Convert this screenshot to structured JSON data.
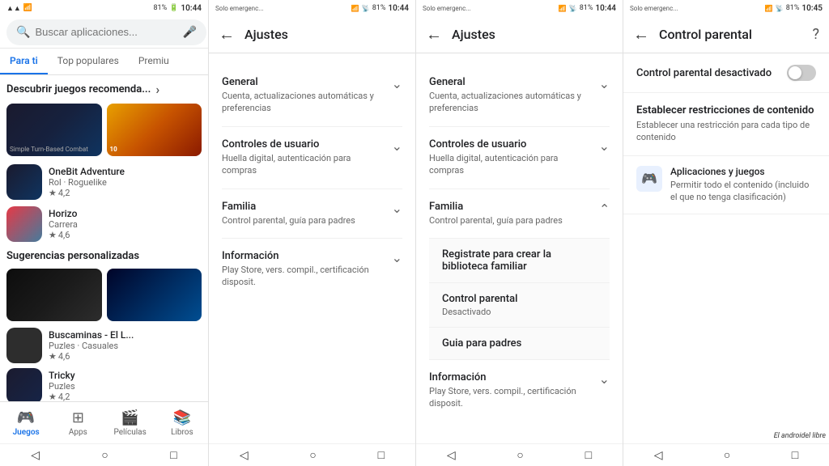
{
  "panels": {
    "panel1": {
      "statusBar": {
        "battery": "81%",
        "time": "10:44",
        "icons": "📶 📡 🔋"
      },
      "searchPlaceholder": "Buscar aplicaciones...",
      "tabs": [
        {
          "label": "Para ti",
          "active": true
        },
        {
          "label": "Top populares",
          "active": false
        },
        {
          "label": "Premiu",
          "active": false
        }
      ],
      "discoverTitle": "Descubrir juegos recomenda...",
      "games": [
        {
          "name": "OneBit Adventure",
          "meta1": "Rol · Roguelike",
          "rating": "4,2"
        },
        {
          "name": "Horizo",
          "meta1": "Carrera",
          "rating": "4,6"
        }
      ],
      "suggestionsTitle": "Sugerencias personalizadas",
      "suggestions": [
        {
          "name": "Buscaminas - El L...",
          "meta1": "Puzles · Casuales",
          "rating": "4,6"
        },
        {
          "name": "Tricky",
          "meta1": "Puzles",
          "rating": "4,2"
        }
      ],
      "bottomNav": [
        {
          "label": "Juegos",
          "active": true
        },
        {
          "label": "Apps",
          "active": false
        },
        {
          "label": "Películas",
          "active": false
        },
        {
          "label": "Libros",
          "active": false
        }
      ]
    },
    "panel2": {
      "statusBar": {
        "emergency": "Solo emergenc...",
        "battery": "81%",
        "time": "10:44"
      },
      "title": "Ajustes",
      "sections": [
        {
          "title": "General",
          "subtitle": "Cuenta, actualizaciones automáticas y preferencias",
          "expanded": false
        },
        {
          "title": "Controles de usuario",
          "subtitle": "Huella digital, autenticación para compras",
          "expanded": false
        },
        {
          "title": "Familia",
          "subtitle": "Control parental, guía para padres",
          "expanded": false
        },
        {
          "title": "Información",
          "subtitle": "Play Store, vers. compil., certificación disposit.",
          "expanded": false
        }
      ]
    },
    "panel3": {
      "statusBar": {
        "emergency": "Solo emergenc...",
        "battery": "81%",
        "time": "10:44"
      },
      "title": "Ajustes",
      "sections": [
        {
          "title": "General",
          "subtitle": "Cuenta, actualizaciones automáticas y preferencias",
          "expanded": false
        },
        {
          "title": "Controles de usuario",
          "subtitle": "Huella digital, autenticación para compras",
          "expanded": false
        },
        {
          "title": "Familia",
          "subtitle": "Control parental, guía para padres",
          "expanded": true
        }
      ],
      "familyItems": [
        {
          "title": "Registrate para crear la biblioteca familiar",
          "sub": ""
        },
        {
          "title": "Control parental",
          "sub": "Desactivado"
        },
        {
          "title": "Guia para padres",
          "sub": ""
        }
      ],
      "infoSection": {
        "title": "Información",
        "subtitle": "Play Store, vers. compil., certificación disposit."
      }
    },
    "panel4": {
      "statusBar": {
        "emergency": "Solo emergenc...",
        "battery": "81%",
        "time": "10:45"
      },
      "title": "Control parental",
      "toggleLabel": "Control parental desactivado",
      "toggleState": "off",
      "restrictionTitle": "Establecer restricciones de contenido",
      "restrictionSub": "Establecer una restricción para cada tipo de contenido",
      "appGamesTitle": "Aplicaciones y juegos",
      "appGamesSub": "Permitir todo el contenido (incluido el que no tenga clasificación)",
      "watermark": "El androidel libre"
    }
  }
}
